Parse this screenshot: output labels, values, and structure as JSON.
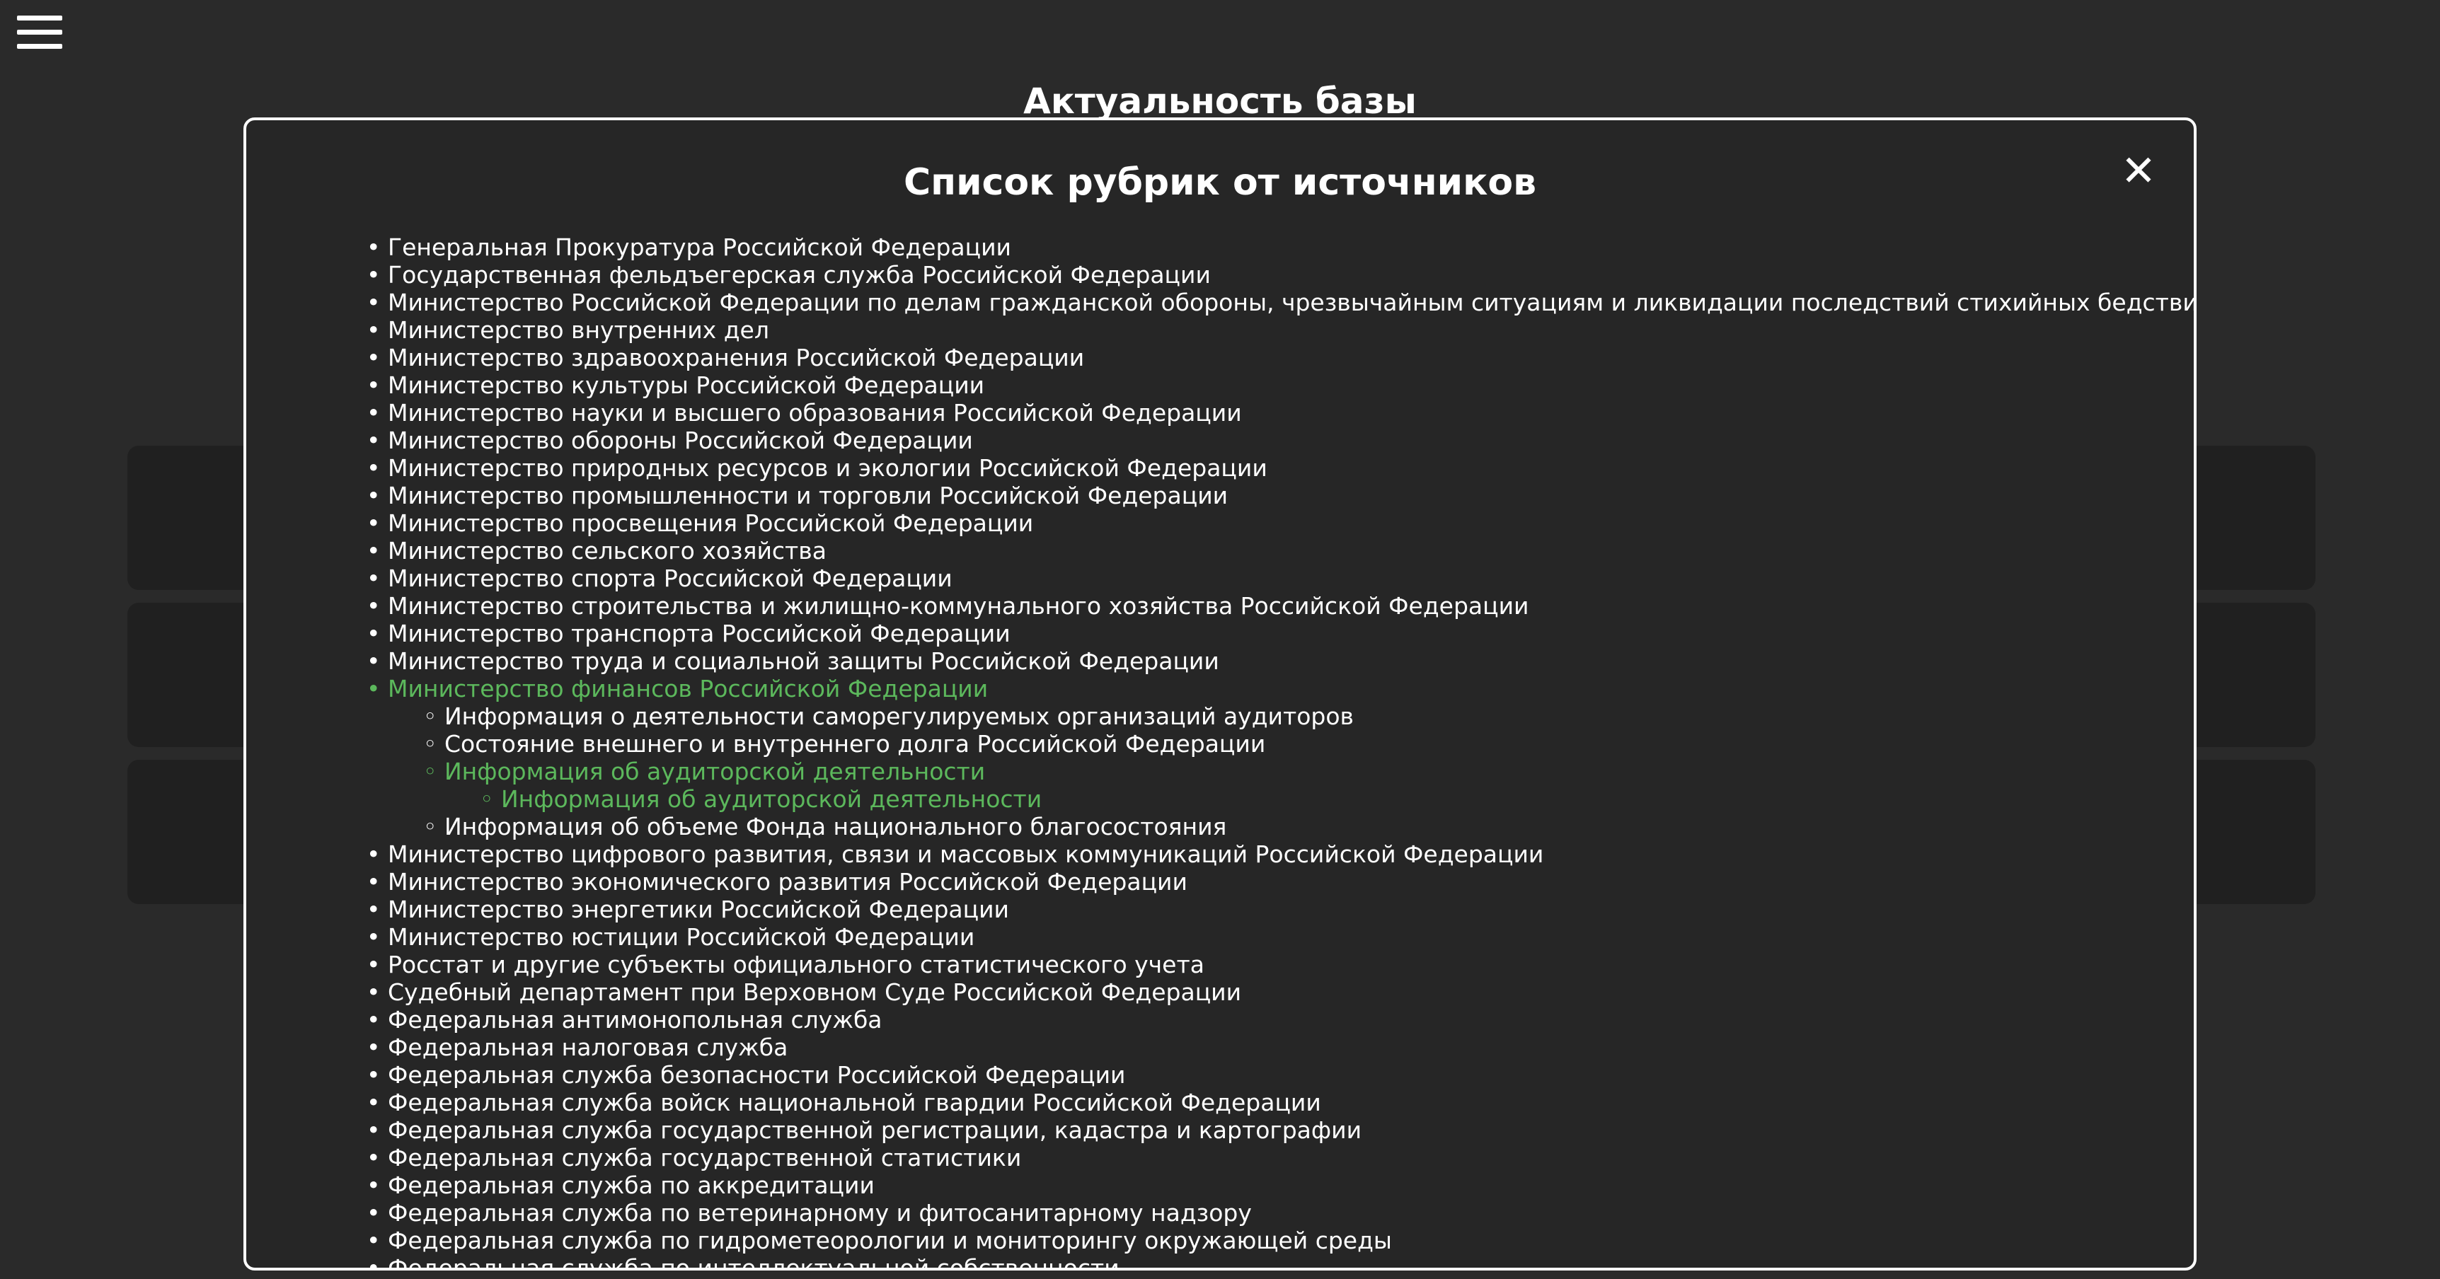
{
  "page": {
    "title": "Актуальность базы"
  },
  "modal": {
    "title": "Список рубрик от источников",
    "close_label": "✕",
    "items": [
      {
        "label": "Генеральная Прокуратура Российской Федерации",
        "level": 0,
        "active": false
      },
      {
        "label": "Государственная фельдъегерская служба Российской Федерации",
        "level": 0,
        "active": false
      },
      {
        "label": "Министерство Российской Федерации по делам гражданской обороны, чрезвычайным ситуациям и ликвидации последствий стихийных бедствий",
        "level": 0,
        "active": false
      },
      {
        "label": "Министерство внутренних дел",
        "level": 0,
        "active": false
      },
      {
        "label": "Министерство здравоохранения Российской Федерации",
        "level": 0,
        "active": false
      },
      {
        "label": "Министерство культуры Российской Федерации",
        "level": 0,
        "active": false
      },
      {
        "label": "Министерство науки и высшего образования Российской Федерации",
        "level": 0,
        "active": false
      },
      {
        "label": "Министерство обороны Российской Федерации",
        "level": 0,
        "active": false
      },
      {
        "label": "Министерство природных ресурсов и экологии Российской Федерации",
        "level": 0,
        "active": false
      },
      {
        "label": "Министерство промышленности и торговли Российской Федерации",
        "level": 0,
        "active": false
      },
      {
        "label": "Министерство просвещения Российской Федерации",
        "level": 0,
        "active": false
      },
      {
        "label": "Министерство сельского хозяйства",
        "level": 0,
        "active": false
      },
      {
        "label": "Министерство спорта Российской Федерации",
        "level": 0,
        "active": false
      },
      {
        "label": "Министерство строительства и жилищно-коммунального хозяйства Российской Федерации",
        "level": 0,
        "active": false
      },
      {
        "label": "Министерство транспорта Российской Федерации",
        "level": 0,
        "active": false
      },
      {
        "label": "Министерство труда и социальной защиты Российской Федерации",
        "level": 0,
        "active": false
      },
      {
        "label": "Министерство финансов Российской Федерации",
        "level": 0,
        "active": true
      },
      {
        "label": "Информация о деятельности саморегулируемых организаций аудиторов",
        "level": 1,
        "active": false
      },
      {
        "label": "Состояние внешнего и внутреннего долга Российской Федерации",
        "level": 1,
        "active": false
      },
      {
        "label": "Информация об аудиторской деятельности",
        "level": 1,
        "active": true
      },
      {
        "label": "Информация об аудиторской деятельности",
        "level": 2,
        "active": true
      },
      {
        "label": "Информация об объеме Фонда национального благосостояния",
        "level": 1,
        "active": false
      },
      {
        "label": "Министерство цифрового развития, связи и массовых коммуникаций Российской Федерации",
        "level": 0,
        "active": false
      },
      {
        "label": "Министерство экономического развития Российской Федерации",
        "level": 0,
        "active": false
      },
      {
        "label": "Министерство энергетики Российской Федерации",
        "level": 0,
        "active": false
      },
      {
        "label": "Министерство юстиции Российской Федерации",
        "level": 0,
        "active": false
      },
      {
        "label": "Росстат и другие субъекты официального статистического учета",
        "level": 0,
        "active": false
      },
      {
        "label": "Судебный департамент при Верховном Суде Российской Федерации",
        "level": 0,
        "active": false
      },
      {
        "label": "Федеральная антимонопольная служба",
        "level": 0,
        "active": false
      },
      {
        "label": "Федеральная налоговая служба",
        "level": 0,
        "active": false
      },
      {
        "label": "Федеральная служба безопасности Российской Федерации",
        "level": 0,
        "active": false
      },
      {
        "label": "Федеральная служба войск национальной гвардии Российской Федерации",
        "level": 0,
        "active": false
      },
      {
        "label": "Федеральная служба государственной регистрации, кадастра и картографии",
        "level": 0,
        "active": false
      },
      {
        "label": "Федеральная служба государственной статистики",
        "level": 0,
        "active": false
      },
      {
        "label": "Федеральная служба по аккредитации",
        "level": 0,
        "active": false
      },
      {
        "label": "Федеральная служба по ветеринарному и фитосанитарному надзору",
        "level": 0,
        "active": false
      },
      {
        "label": "Федеральная служба по гидрометеорологии и мониторингу окружающей среды",
        "level": 0,
        "active": false
      },
      {
        "label": "Федеральная служба по интеллектуальной собственности",
        "level": 0,
        "active": false
      }
    ]
  },
  "colors": {
    "background": "#2a2a2a",
    "modal_background": "#262626",
    "active": "#5cb85c",
    "text": "#ffffff"
  },
  "icons": {
    "menu": "hamburger-menu-icon",
    "close": "close-icon"
  }
}
